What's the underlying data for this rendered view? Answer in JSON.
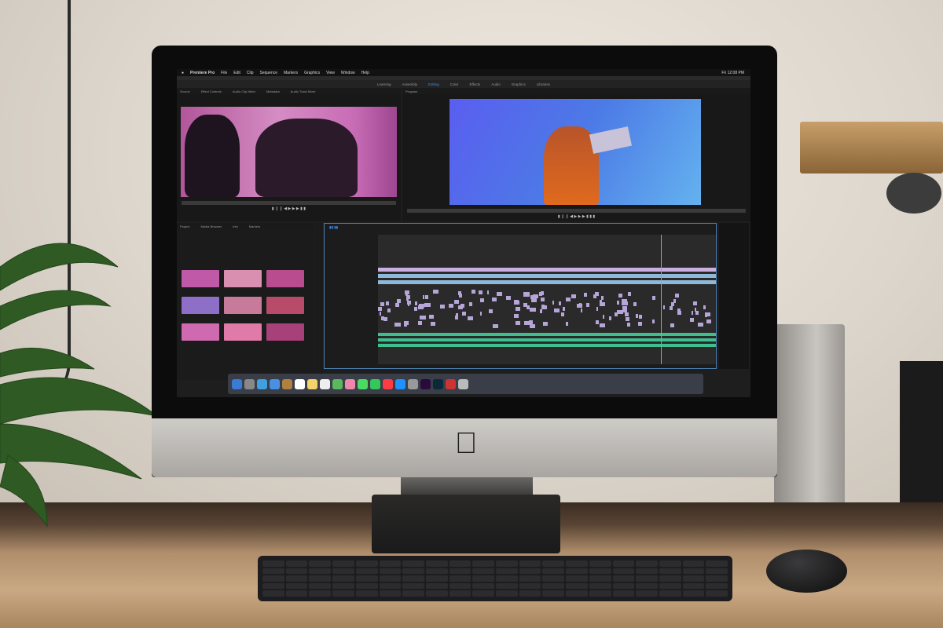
{
  "scene": "iMac on a wooden desk running a video editor",
  "menubar": {
    "apple_icon": "apple-logo",
    "items": [
      "Premiere Pro",
      "File",
      "Edit",
      "Clip",
      "Sequence",
      "Markers",
      "Graphics",
      "View",
      "Window",
      "Help"
    ],
    "clock": "Fri 12:08 PM"
  },
  "workspaces": {
    "items": [
      "Learning",
      "Assembly",
      "Editing",
      "Color",
      "Effects",
      "Audio",
      "Graphics",
      "Libraries"
    ],
    "active": "Editing"
  },
  "source_panel": {
    "tabs": [
      "Source",
      "Effect Controls",
      "Audio Clip Mixer",
      "Metadata",
      "Audio Track Mixer"
    ]
  },
  "program_panel": {
    "tab": "Program"
  },
  "project_panel": {
    "tabs": [
      "Project",
      "Media Browser",
      "Info",
      "Markers"
    ]
  },
  "colors": {
    "accent": "#3d8be0",
    "video_clip": "#b6a5d8",
    "audio_clip": "#3fbf90",
    "timeline_border": "#4d7fb0"
  },
  "dock": {
    "icons": [
      "finder",
      "launchpad",
      "safari",
      "mail",
      "contacts",
      "calendar",
      "notes",
      "reminders",
      "maps",
      "photos",
      "messages",
      "facetime",
      "music",
      "app-store",
      "system-preferences",
      "premiere-pro",
      "lightroom",
      "photo-booth",
      "trash"
    ]
  }
}
